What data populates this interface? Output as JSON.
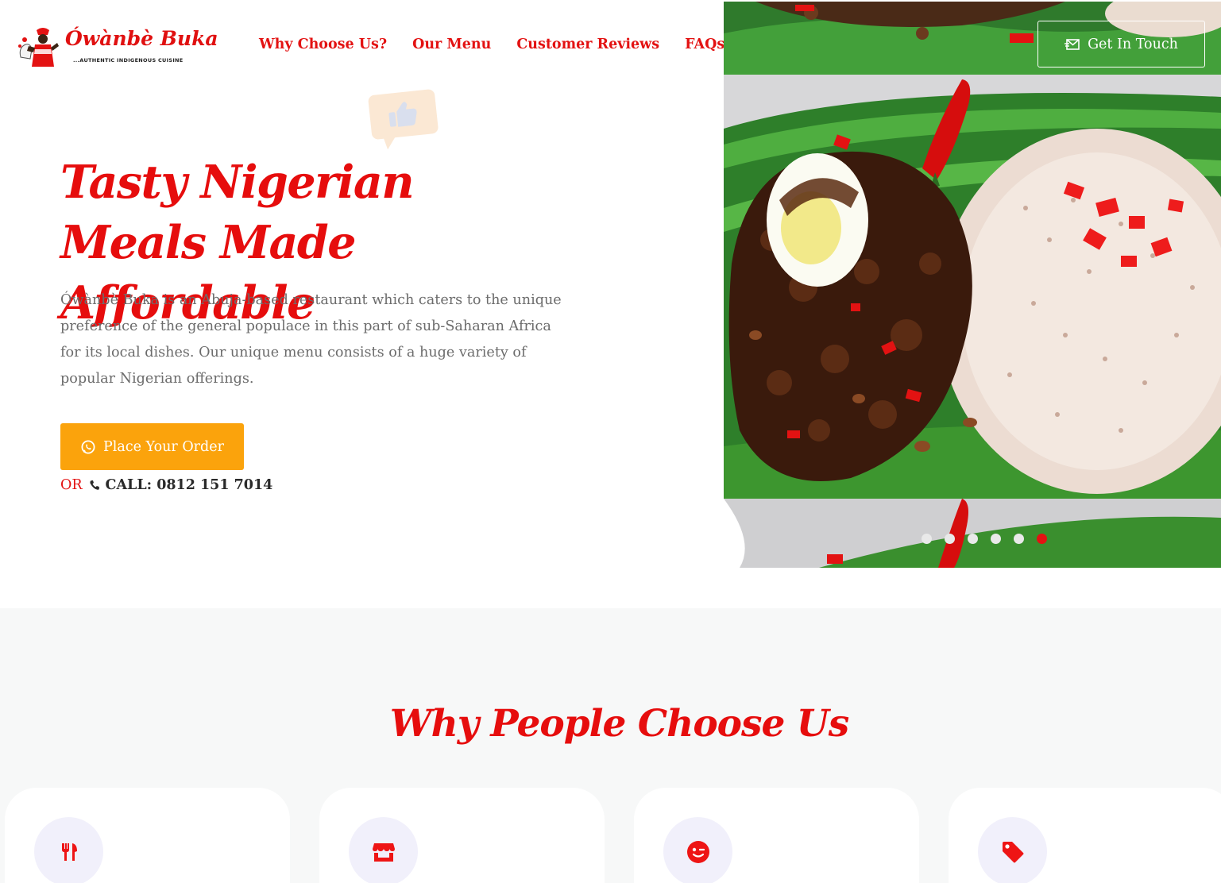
{
  "brand": {
    "name": "Ówànbè Buka",
    "tagline": "...AUTHENTIC INDIGENOUS CUISINE",
    "accent_color": "#e31212",
    "button_color": "#fba30c"
  },
  "nav": {
    "items": [
      {
        "label": "Why Choose Us?"
      },
      {
        "label": "Our Menu"
      },
      {
        "label": "Customer Reviews"
      },
      {
        "label": "FAQs"
      }
    ],
    "contact_label": "Get In Touch",
    "contact_icon": "envelope-icon"
  },
  "hero": {
    "title": "Tasty Nigerian Meals Made Affordable",
    "description": "Ówànbè Buka is an Abuja-based restaurant which caters to the unique preference of the general populace in this part of sub-Saharan Africa for its local dishes. Our unique menu consists of a huge variety of popular Nigerian offerings.",
    "order_button": "Place Your Order",
    "order_icon": "whatsapp-icon",
    "or_text": "OR",
    "call_text": "CALL: 0812 151 7014",
    "call_icon": "phone-icon"
  },
  "slider": {
    "slides": 6,
    "active_index": 5
  },
  "why": {
    "title": "Why People Choose Us",
    "cards": [
      {
        "icon": "utensils-icon"
      },
      {
        "icon": "store-icon"
      },
      {
        "icon": "wink-icon"
      },
      {
        "icon": "tag-icon"
      }
    ]
  }
}
